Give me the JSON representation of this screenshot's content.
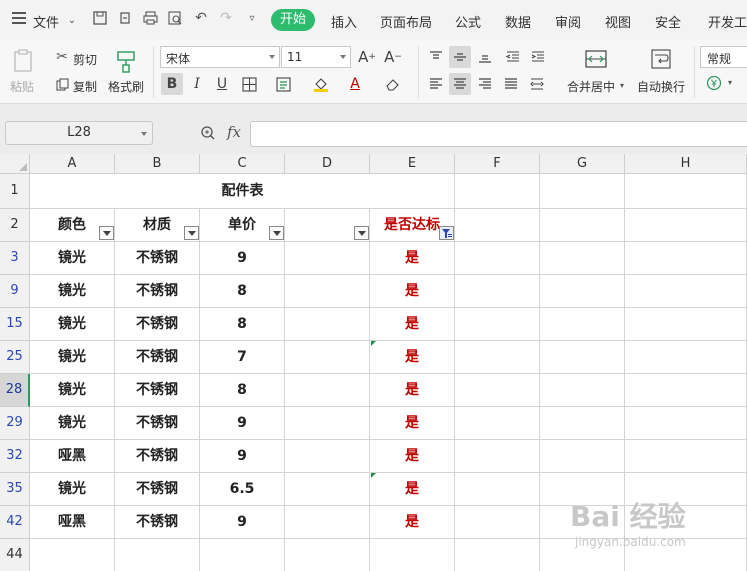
{
  "menu": {
    "file_label": "文件",
    "tabs": [
      "开始",
      "插入",
      "页面布局",
      "公式",
      "数据",
      "审阅",
      "视图",
      "安全",
      "开发工具"
    ],
    "active_tab": "开始"
  },
  "ribbon": {
    "paste": "粘贴",
    "cut": "剪切",
    "copy": "复制",
    "format_painter": "格式刷",
    "font_name": "宋体",
    "font_size": "11",
    "merge_center": "合并居中",
    "wrap_text": "自动换行",
    "number_format": "常规",
    "bold": "B",
    "italic": "I",
    "underline": "U",
    "font_color": "A",
    "increase_font": "A⁺",
    "decrease_font": "A⁻"
  },
  "formula_bar": {
    "name_box": "L28",
    "fx": "fx",
    "formula": ""
  },
  "sheet": {
    "columns": [
      "A",
      "B",
      "C",
      "D",
      "E",
      "F",
      "G",
      "H"
    ],
    "title": "配件表",
    "headers": [
      "颜色",
      "材质",
      "单价",
      "",
      "是否达标"
    ],
    "rows": [
      {
        "num": "3",
        "a": "镜光",
        "b": "不锈钢",
        "c": "9",
        "e": "是"
      },
      {
        "num": "9",
        "a": "镜光",
        "b": "不锈钢",
        "c": "8",
        "e": "是"
      },
      {
        "num": "15",
        "a": "镜光",
        "b": "不锈钢",
        "c": "8",
        "e": "是"
      },
      {
        "num": "25",
        "a": "镜光",
        "b": "不锈钢",
        "c": "7",
        "e": "是"
      },
      {
        "num": "28",
        "a": "镜光",
        "b": "不锈钢",
        "c": "8",
        "e": "是"
      },
      {
        "num": "29",
        "a": "镜光",
        "b": "不锈钢",
        "c": "9",
        "e": "是"
      },
      {
        "num": "32",
        "a": "哑黑",
        "b": "不锈钢",
        "c": "9",
        "e": "是"
      },
      {
        "num": "35",
        "a": "镜光",
        "b": "不锈钢",
        "c": "6.5",
        "e": "是"
      },
      {
        "num": "42",
        "a": "哑黑",
        "b": "不锈钢",
        "c": "9",
        "e": "是"
      }
    ],
    "row_labels": [
      "1",
      "2",
      "44"
    ],
    "selected_row": "28"
  },
  "watermark": {
    "brand": "Bai 经验",
    "url": "jingyan.baidu.com"
  },
  "colors": {
    "accent_green": "#2dbb6e",
    "filtered_row_blue": "#2a49b0",
    "header_red": "#c00000"
  }
}
